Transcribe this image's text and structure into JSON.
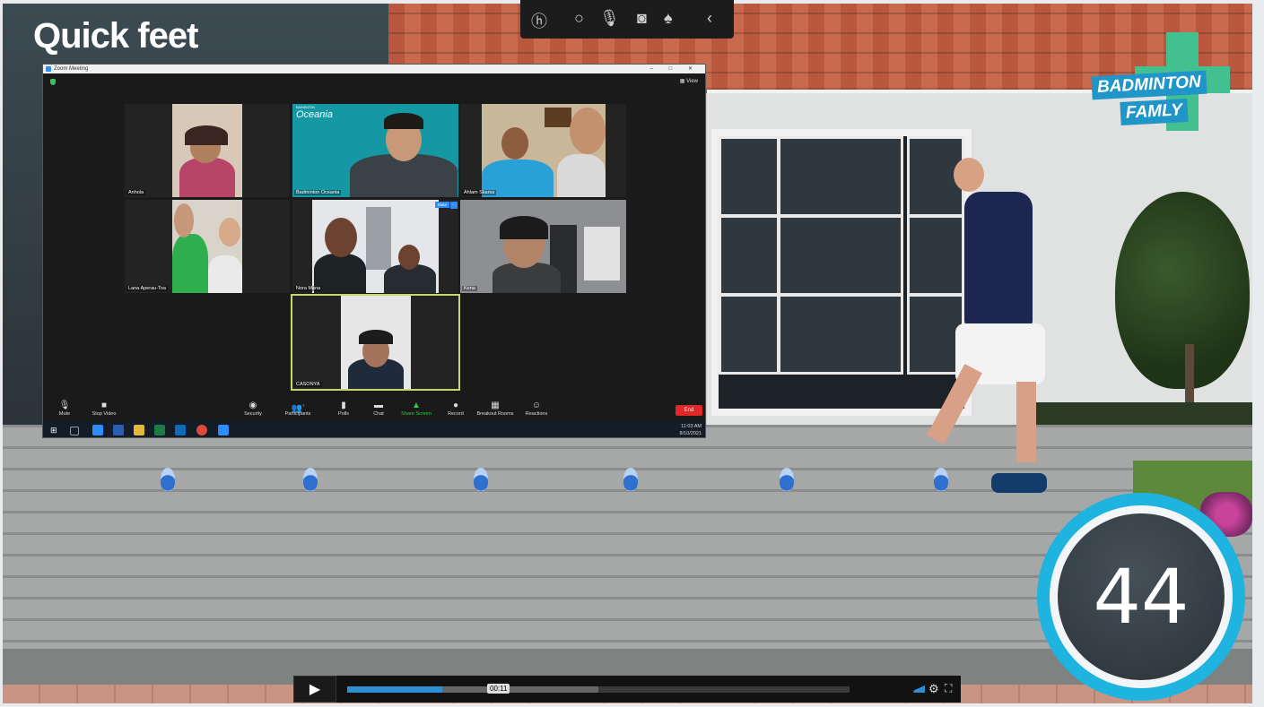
{
  "video": {
    "title": "Quick feet",
    "logo_line1": "BADMINTON",
    "logo_line2": "FAMLY",
    "countdown": "44",
    "player": {
      "play_icon": "play-icon",
      "timestamp": "00:11",
      "progress": 0.19,
      "buffered": 0.5
    }
  },
  "zoom": {
    "window_title": "Zoom Meeting",
    "view_label": "View",
    "window_controls": "– □ ✕",
    "participants": [
      {
        "name": "Anhola"
      },
      {
        "name": "Badminton Oceania",
        "banner_small": "BADMINTON",
        "banner": "Oceania"
      },
      {
        "name": "Ahlam Skarsa"
      },
      {
        "name": "Lana Aperau-Toa"
      },
      {
        "name": "Nora Mana",
        "mute_label": "Mute"
      },
      {
        "name": "Kena"
      },
      {
        "name": "CASONYA"
      }
    ],
    "controls": [
      {
        "label": "Mute",
        "icon": "microphone-icon",
        "glyph": "🎙"
      },
      {
        "label": "Stop Video",
        "icon": "video-camera-icon",
        "glyph": "■"
      },
      {
        "label": "Security",
        "icon": "shield-icon",
        "glyph": "◉"
      },
      {
        "label": "Participants",
        "icon": "participants-icon",
        "glyph": "👥",
        "count": "7"
      },
      {
        "label": "Polls",
        "icon": "polls-icon",
        "glyph": "▮"
      },
      {
        "label": "Chat",
        "icon": "chat-icon",
        "glyph": "▬"
      },
      {
        "label": "Share Screen",
        "icon": "share-screen-icon",
        "glyph": "▲"
      },
      {
        "label": "Record",
        "icon": "record-icon",
        "glyph": "●"
      },
      {
        "label": "Breakout Rooms",
        "icon": "breakout-rooms-icon",
        "glyph": "▦"
      },
      {
        "label": "Reactions",
        "icon": "reactions-icon",
        "glyph": "☺"
      }
    ],
    "end_label": "End",
    "clock_time": "11:03 AM",
    "clock_date": "8/10/2021"
  },
  "colors": {
    "timer_ring": "#1fb3df",
    "share_green": "#2ecc40",
    "end_red": "#e02828",
    "active_speaker": "#c8d66b"
  }
}
